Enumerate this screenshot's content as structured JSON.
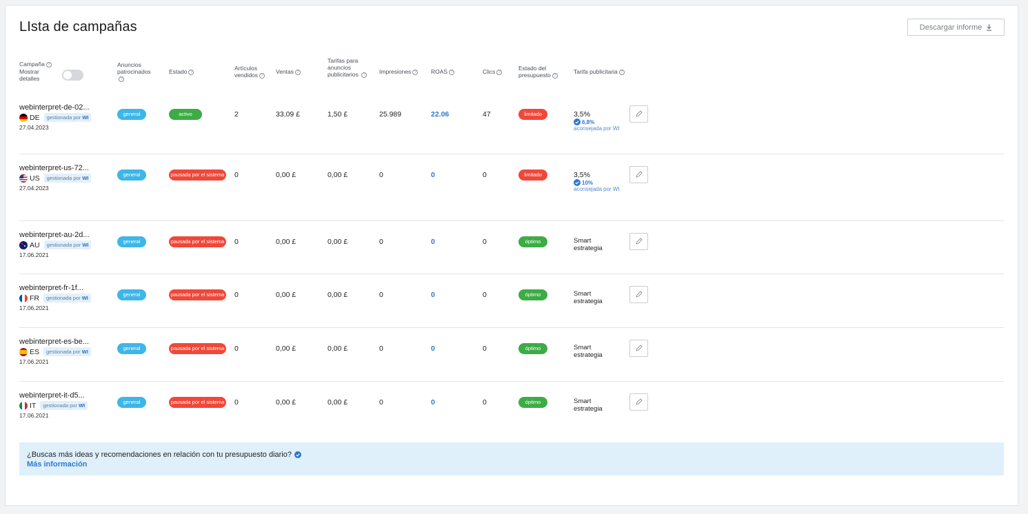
{
  "page": {
    "title": "LIsta de campañas",
    "download_label": "Descargar informe"
  },
  "headers": {
    "campaign": "Campaña",
    "show_details": "Mostrar detalles",
    "sponsored": "Anuncios patrocinados",
    "status": "Estado",
    "items_sold": "Artículos vendidos",
    "sales": "Ventas",
    "ad_fees": "Tarifas para anuncios publicitarios",
    "impressions": "Impresiones",
    "roas": "ROAS",
    "clicks": "Clics",
    "budget_status": "Estado del presupuesto",
    "ad_rate": "Tarifa publicitaria"
  },
  "managed_prefix": "gestionada por",
  "managed_by": "WI",
  "rows": [
    {
      "name": "webinterpret-de-02...",
      "country": "DE",
      "date": "27.04.2023",
      "sponsored": "general",
      "status": "activo",
      "status_type": "active",
      "items": "2",
      "sales": "33,09 £",
      "fees": "1,50 £",
      "impressions": "25.989",
      "roas": "22.06",
      "clicks": "47",
      "budget": "limitado",
      "budget_type": "limited",
      "rate": "3,5%",
      "rec_rate": "6,8%",
      "rec_text": "aconsejada por WI"
    },
    {
      "name": "webinterpret-us-72...",
      "country": "US",
      "date": "27.04.2023",
      "sponsored": "general",
      "status": "pausada por el sistema",
      "status_type": "paused",
      "items": "0",
      "sales": "0,00 £",
      "fees": "0,00 £",
      "impressions": "0",
      "roas": "0",
      "clicks": "0",
      "budget": "limitado",
      "budget_type": "limited",
      "rate": "3,5%",
      "rec_rate": "10%",
      "rec_text": "aconsejada por WI"
    },
    {
      "name": "webinterpret-au-2d...",
      "country": "AU",
      "date": "17.06.2021",
      "sponsored": "general",
      "status": "pausada por el sistema",
      "status_type": "paused",
      "items": "0",
      "sales": "0,00 £",
      "fees": "0,00 £",
      "impressions": "0",
      "roas": "0",
      "clicks": "0",
      "budget": "óptimo",
      "budget_type": "optimal",
      "rate": "Smart estrategia"
    },
    {
      "name": "webinterpret-fr-1f...",
      "country": "FR",
      "date": "17.06.2021",
      "sponsored": "general",
      "status": "pausada por el sistema",
      "status_type": "paused",
      "items": "0",
      "sales": "0,00 £",
      "fees": "0,00 £",
      "impressions": "0",
      "roas": "0",
      "clicks": "0",
      "budget": "óptimo",
      "budget_type": "optimal",
      "rate": "Smart estrategia"
    },
    {
      "name": "webinterpret-es-be...",
      "country": "ES",
      "date": "17.06.2021",
      "sponsored": "general",
      "status": "pausada por el sistema",
      "status_type": "paused",
      "items": "0",
      "sales": "0,00 £",
      "fees": "0,00 £",
      "impressions": "0",
      "roas": "0",
      "clicks": "0",
      "budget": "óptimo",
      "budget_type": "optimal",
      "rate": "Smart estrategia"
    },
    {
      "name": "webinterpret-it-d5...",
      "country": "IT",
      "date": "17.06.2021",
      "sponsored": "general",
      "status": "pausada por el sistema",
      "status_type": "paused",
      "items": "0",
      "sales": "0,00 £",
      "fees": "0,00 £",
      "impressions": "0",
      "roas": "0",
      "clicks": "0",
      "budget": "óptimo",
      "budget_type": "optimal",
      "rate": "Smart estrategia"
    }
  ],
  "banner": {
    "question": "¿Buscas más ideas y recomendaciones en relación con tu presupuesto diario?",
    "link": "Más información"
  },
  "colors": {
    "blue_pill": "#3db6e8",
    "green": "#3cac45",
    "red": "#f24738",
    "link": "#2e77d0"
  }
}
